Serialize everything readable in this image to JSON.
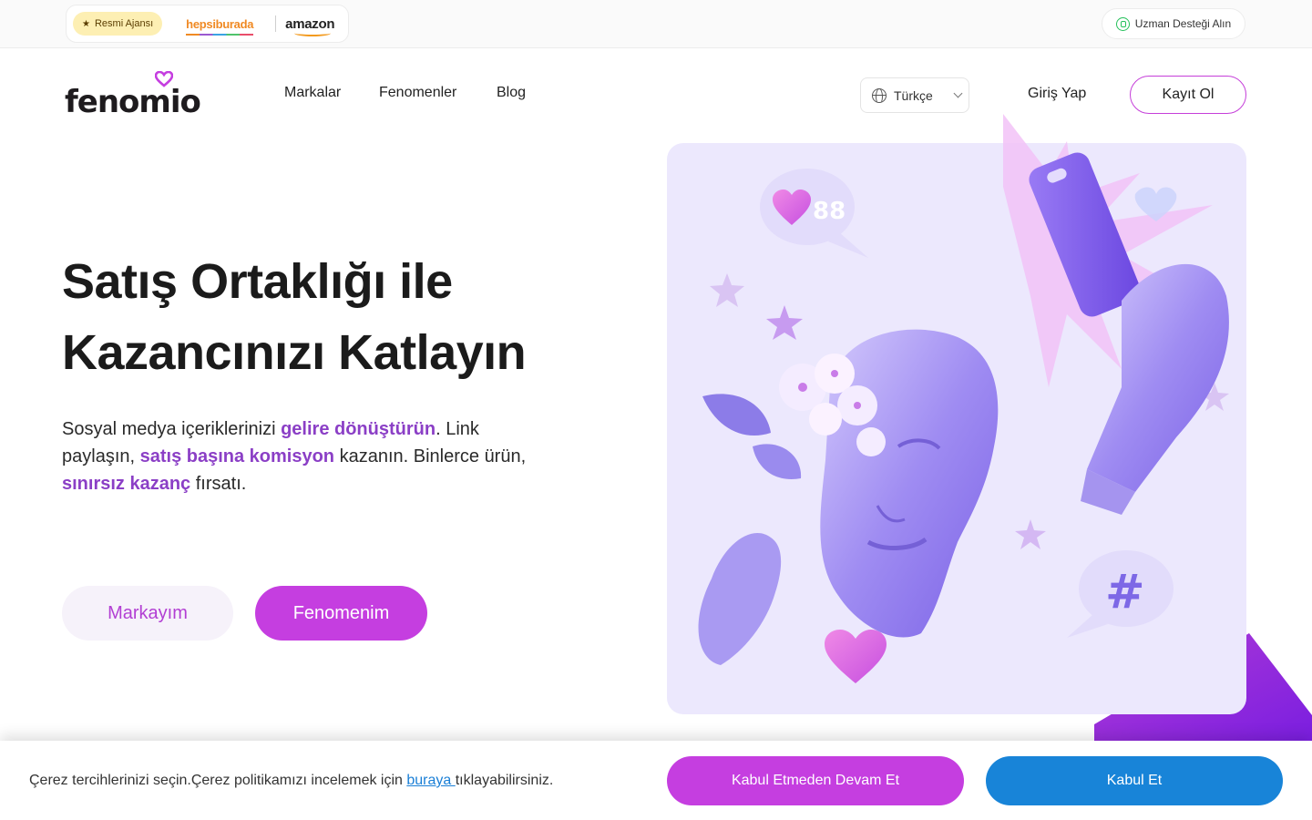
{
  "topbar": {
    "badge_label": "Resmi Ajansı",
    "partner_1": "hepsiburada",
    "partner_2": "amazon",
    "support_label": "Uzman Desteği Alın"
  },
  "nav": {
    "brand": "fenomio",
    "links": [
      "Markalar",
      "Fenomenler",
      "Blog"
    ],
    "language": "Türkçe",
    "login": "Giriş Yap",
    "signup": "Kayıt Ol"
  },
  "hero": {
    "title_line1": "Satış Ortaklığı ile",
    "title_line2": "Kazancınızı Katlayın",
    "text_1": "Sosyal medya içeriklerinizi ",
    "hl_1": "gelire dönüştürün",
    "text_2": ". Link paylaşın, ",
    "hl_2": "satış başına komisyon",
    "text_3": " kazanın. Binlerce ürün, ",
    "hl_3": "sınırsız kazanç",
    "text_4": " fırsatı.",
    "btn_brand": "Markayım",
    "btn_influencer": "Fenomenim"
  },
  "illustration": {
    "like_count": "88",
    "hashtag": "#"
  },
  "cookie": {
    "text_before": "Çerez tercihlerinizi seçin.Çerez politikamızı incelemek için ",
    "link": "buraya ",
    "text_after": "tıklayabilirsiniz.",
    "decline": "Kabul Etmeden Devam Et",
    "accept": "Kabul Et"
  },
  "colors": {
    "primary": "#c53ee0",
    "accept": "#1884d8",
    "highlight": "#8b3fc6"
  }
}
